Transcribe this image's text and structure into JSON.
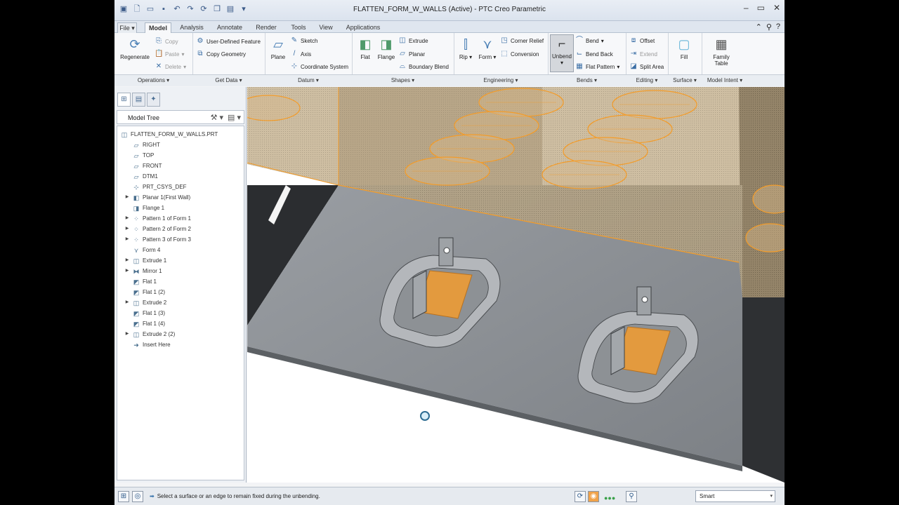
{
  "window": {
    "title": "FLATTEN_FORM_W_WALLS (Active) - PTC Creo Parametric"
  },
  "tabs": [
    "File ▾",
    "Model",
    "Analysis",
    "Annotate",
    "Render",
    "Tools",
    "View",
    "Applications"
  ],
  "ribbon": {
    "operations": {
      "regenerate": "Regenerate",
      "copy": "Copy",
      "paste": "Paste",
      "delete": "Delete"
    },
    "get_data": {
      "udf": "User-Defined Feature",
      "copy_geometry": "Copy Geometry"
    },
    "datum": {
      "plane": "Plane",
      "sketch": "Sketch",
      "axis": "Axis",
      "csys": "Coordinate System"
    },
    "shapes": {
      "flat": "Flat",
      "flange": "Flange",
      "extrude": "Extrude",
      "planar": "Planar",
      "boundary_blend": "Boundary Blend"
    },
    "engineering": {
      "rip": "Rip",
      "form": "Form",
      "corner_relief": "Corner Relief",
      "conversion": "Conversion"
    },
    "bends": {
      "unbend": "Unbend",
      "bend": "Bend",
      "bend_back": "Bend Back",
      "flat_pattern": "Flat Pattern"
    },
    "editing": {
      "offset": "Offset",
      "extend": "Extend",
      "split_area": "Split Area"
    },
    "surface": {
      "fill": "Fill"
    },
    "model_intent": {
      "family_table_1": "Family",
      "family_table_2": "Table"
    },
    "groups": [
      "Operations ▾",
      "Get Data ▾",
      "Datum ▾",
      "Shapes ▾",
      "Engineering ▾",
      "Bends ▾",
      "Editing ▾",
      "Surface ▾",
      "Model Intent ▾"
    ]
  },
  "model_tree": {
    "header": "Model Tree",
    "items": [
      {
        "label": "FLATTEN_FORM_W_WALLS.PRT",
        "icon": "part-icon",
        "expandable": false
      },
      {
        "label": "RIGHT",
        "icon": "datum-plane-icon",
        "expandable": false
      },
      {
        "label": "TOP",
        "icon": "datum-plane-icon",
        "expandable": false
      },
      {
        "label": "FRONT",
        "icon": "datum-plane-icon",
        "expandable": false
      },
      {
        "label": "DTM1",
        "icon": "datum-plane-icon",
        "expandable": false
      },
      {
        "label": "PRT_CSYS_DEF",
        "icon": "csys-icon",
        "expandable": false
      },
      {
        "label": "Planar 1(First Wall)",
        "icon": "planar-wall-icon",
        "expandable": true
      },
      {
        "label": "Flange 1",
        "icon": "flange-icon",
        "expandable": false
      },
      {
        "label": "Pattern 1 of Form 1",
        "icon": "pattern-icon",
        "expandable": true
      },
      {
        "label": "Pattern 2 of Form 2",
        "icon": "pattern-icon",
        "expandable": true
      },
      {
        "label": "Pattern 3 of Form 3",
        "icon": "pattern-icon",
        "expandable": true
      },
      {
        "label": "Form 4",
        "icon": "form-icon",
        "expandable": false
      },
      {
        "label": "Extrude 1",
        "icon": "extrude-icon",
        "expandable": true
      },
      {
        "label": "Mirror 1",
        "icon": "mirror-icon",
        "expandable": true
      },
      {
        "label": "Flat 1",
        "icon": "flat-icon",
        "expandable": false
      },
      {
        "label": "Flat 1 (2)",
        "icon": "flat-icon",
        "expandable": false
      },
      {
        "label": "Extrude 2",
        "icon": "extrude-icon",
        "expandable": true
      },
      {
        "label": "Flat 1 (3)",
        "icon": "flat-icon",
        "expandable": false
      },
      {
        "label": "Flat 1 (4)",
        "icon": "flat-icon",
        "expandable": false
      },
      {
        "label": "Extrude 2 (2)",
        "icon": "extrude-icon",
        "expandable": true
      },
      {
        "label": "Insert Here",
        "icon": "insert-arrow-icon",
        "expandable": false
      }
    ]
  },
  "status": {
    "message": "Select a surface or an edge to remain fixed during the unbending.",
    "filter": "Smart"
  },
  "colors": {
    "highlight": "#f39c2a",
    "sheet_metal": "#8e9297",
    "dark_surface": "#2e3033"
  }
}
